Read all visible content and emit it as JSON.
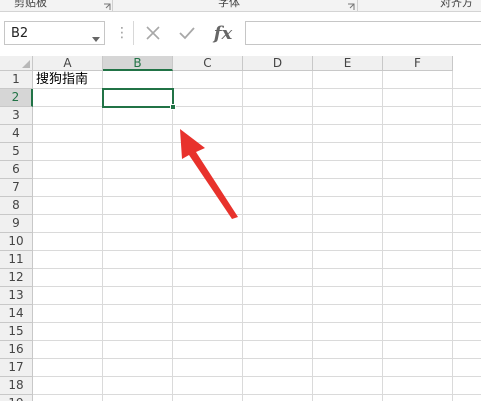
{
  "ribbon": {
    "groups": [
      {
        "label": "剪贴板"
      },
      {
        "label": "字体"
      },
      {
        "label": "对齐方"
      }
    ]
  },
  "namebox": {
    "value": "B2"
  },
  "formula_bar": {
    "function_label": "fx",
    "value": ""
  },
  "columns": [
    "A",
    "B",
    "C",
    "D",
    "E",
    "F"
  ],
  "rows": [
    "1",
    "2",
    "3",
    "4",
    "5",
    "6",
    "7",
    "8",
    "9",
    "10",
    "11",
    "12",
    "13",
    "14",
    "15",
    "16",
    "17",
    "18",
    "19"
  ],
  "selection": {
    "column": "B",
    "row": "2"
  },
  "cells": {
    "A1": "搜狗指南"
  },
  "colors": {
    "accent": "#217346",
    "annotation_arrow": "#e8322c"
  },
  "icons": {
    "cancel": "close-icon",
    "enter": "check-icon",
    "namebox_dropdown": "chevron-down-icon"
  }
}
